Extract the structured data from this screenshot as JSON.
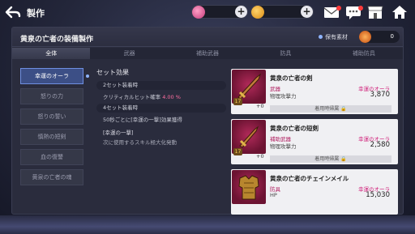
{
  "topbar": {
    "title": "製作",
    "currency": [
      {
        "name": "pink-gem-icon",
        "value": ""
      },
      {
        "name": "gold-coin-icon",
        "value": ""
      }
    ],
    "icons": [
      "mail-icon",
      "chat-icon",
      "shop-icon",
      "home-icon"
    ]
  },
  "panel": {
    "title": "黄泉の亡者の装備製作",
    "owned_label": "保有素材",
    "owned_value": "0"
  },
  "tabs": [
    "全体",
    "武器",
    "補助武器",
    "防具",
    "補助防具"
  ],
  "side": [
    "幸運のオーラ",
    "怒りの力",
    "怒りの誓い",
    "慎熱の短剣",
    "血の復讐",
    "黄泉の亡者の魂"
  ],
  "effects": {
    "title": "セット効果",
    "set2": "2セット装着時",
    "set2_line_prefix": "クリティカルヒット確率",
    "set2_line_value": "4.00 %",
    "set4": "4セット装着時",
    "set4_line": "50秒ごとに[幸運の一撃]効果獲得",
    "skill_name": "[幸運の一撃]",
    "skill_desc": "次に使用するスキル極大化発動"
  },
  "cards": [
    {
      "name": "黄泉の亡者の剣",
      "type": "武器",
      "stat": "物理攻撃力",
      "set": "幸運のオーラ",
      "value": "3,870",
      "lvl": "17",
      "plus": "+0",
      "bar": "着用時帰属 🔒"
    },
    {
      "name": "黄泉の亡者の短剣",
      "type": "補助武器",
      "stat": "物理攻撃力",
      "set": "幸運のオーラ",
      "value": "2,580",
      "lvl": "17",
      "plus": "+0",
      "bar": "着用時帰属 🔒"
    },
    {
      "name": "黄泉の亡者のチェインメイル",
      "type": "防具",
      "stat": "HP",
      "set": "幸運のオーラ",
      "value": "15,030",
      "lvl": "",
      "plus": "",
      "bar": ""
    }
  ]
}
